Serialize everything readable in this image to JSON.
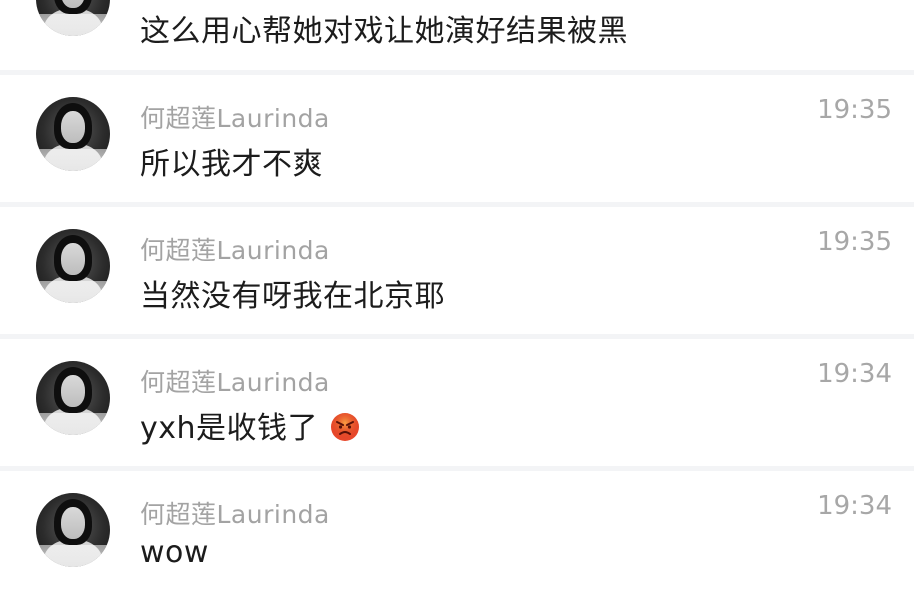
{
  "messages": [
    {
      "name": "",
      "time": "",
      "text": "这么用心帮她对戏让她演好结果被黑",
      "emoji": null
    },
    {
      "name": "何超莲Laurinda",
      "time": "19:35",
      "text": "所以我才不爽",
      "emoji": null
    },
    {
      "name": "何超莲Laurinda",
      "time": "19:35",
      "text": "当然没有呀我在北京耶",
      "emoji": null
    },
    {
      "name": "何超莲Laurinda",
      "time": "19:34",
      "text": "yxh是收钱了",
      "emoji": "angry-face-emoji"
    },
    {
      "name": "何超莲Laurinda",
      "time": "19:34",
      "text": "wow",
      "emoji": null
    }
  ]
}
